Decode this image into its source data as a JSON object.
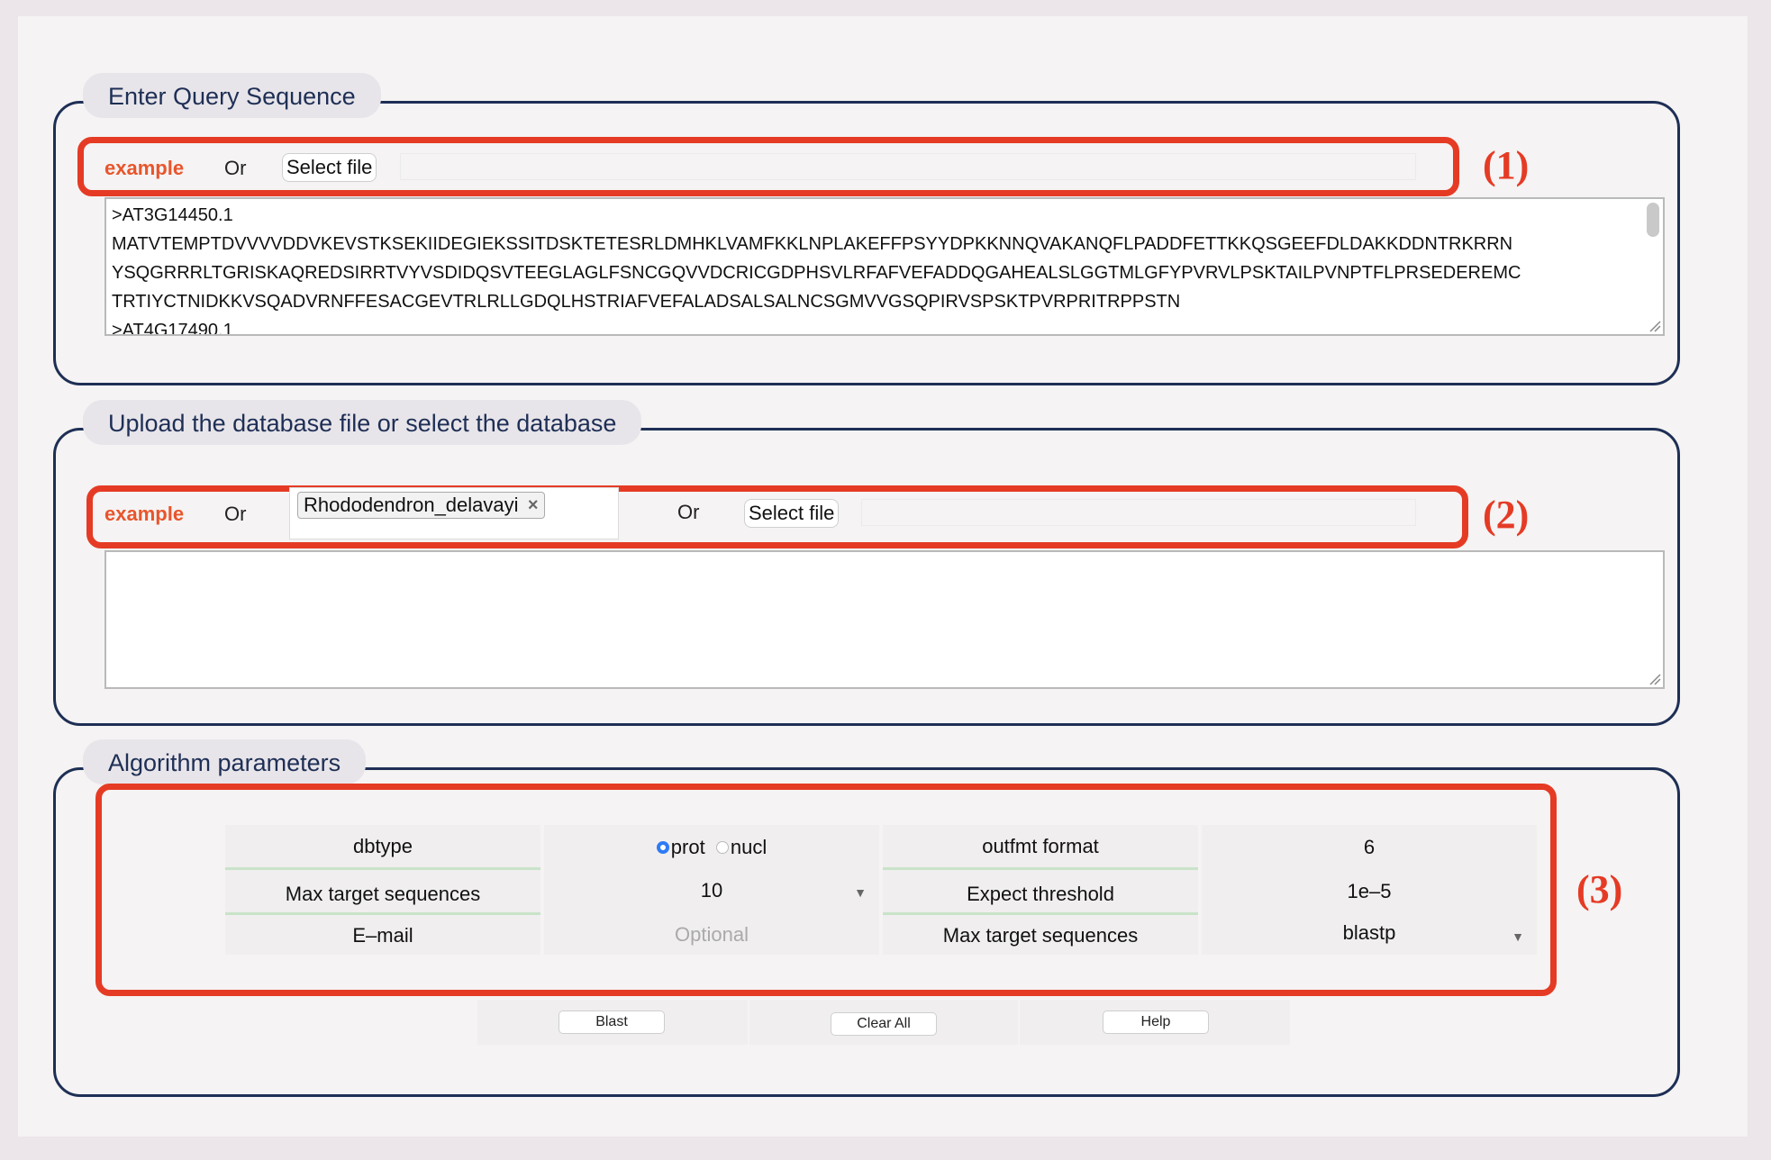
{
  "query_section": {
    "legend": "Enter Query Sequence",
    "example_label": "example",
    "or_label": "Or",
    "select_file_label": "Select file",
    "annotation": "(1)",
    "sequence_lines": [
      ">AT3G14450.1",
      "MATVTEMPTDVVVVDDVKEVSTKSEKIIDEGIEKSSITDSKTETESRLDMHKLVAMFKKLNPLAKEFFPSYYDPKKNNQVAKANQFLPADDFETTKKQSGEEFDLDAKKDDNTRKRRN",
      "YSQGRRRLTGRISKAQREDSIRRTVYVSDIDQSVTEEGLAGLFSNCGQVVDCRICGDPHSVLRFAFVEFADDQGAHEALSLGGTMLGFYPVRVLPSKTAILPVNPTFLPRSEDEREMC",
      "TRTIYCTNIDKKVSQADVRNFFESACGEVTRLRLLGDQLHSTRIAFVEFALADSALSALNCSGMVVGSQPIRVSPSKTPVRPRITRPPSTN",
      ">AT4G17490.1"
    ]
  },
  "database_section": {
    "legend": "Upload the database file or select the database",
    "example_label": "example",
    "or_label_1": "Or",
    "selected_db": "Rhododendron_delavayi",
    "or_label_2": "Or",
    "select_file_label": "Select file",
    "annotation": "(2)"
  },
  "params_section": {
    "legend": "Algorithm parameters",
    "annotation": "(3)",
    "dbtype_label": "dbtype",
    "dbtype_options": [
      "prot",
      "nucl"
    ],
    "dbtype_selected": "prot",
    "outfmt_label": "outfmt format",
    "outfmt_value": "6",
    "max_target_label": "Max target sequences",
    "max_target_value": "10",
    "expect_label": "Expect threshold",
    "expect_value": "1e–5",
    "email_label": "E–mail",
    "email_placeholder": "Optional",
    "program_label": "Max target sequences",
    "program_value": "blastp"
  },
  "buttons": {
    "blast": "Blast",
    "clear_all": "Clear All",
    "help": "Help"
  },
  "colors": {
    "accent_red": "#e53b25",
    "border_navy": "#1e2f55",
    "example_orange": "#e8552c",
    "radio_blue": "#2f7bf5"
  }
}
